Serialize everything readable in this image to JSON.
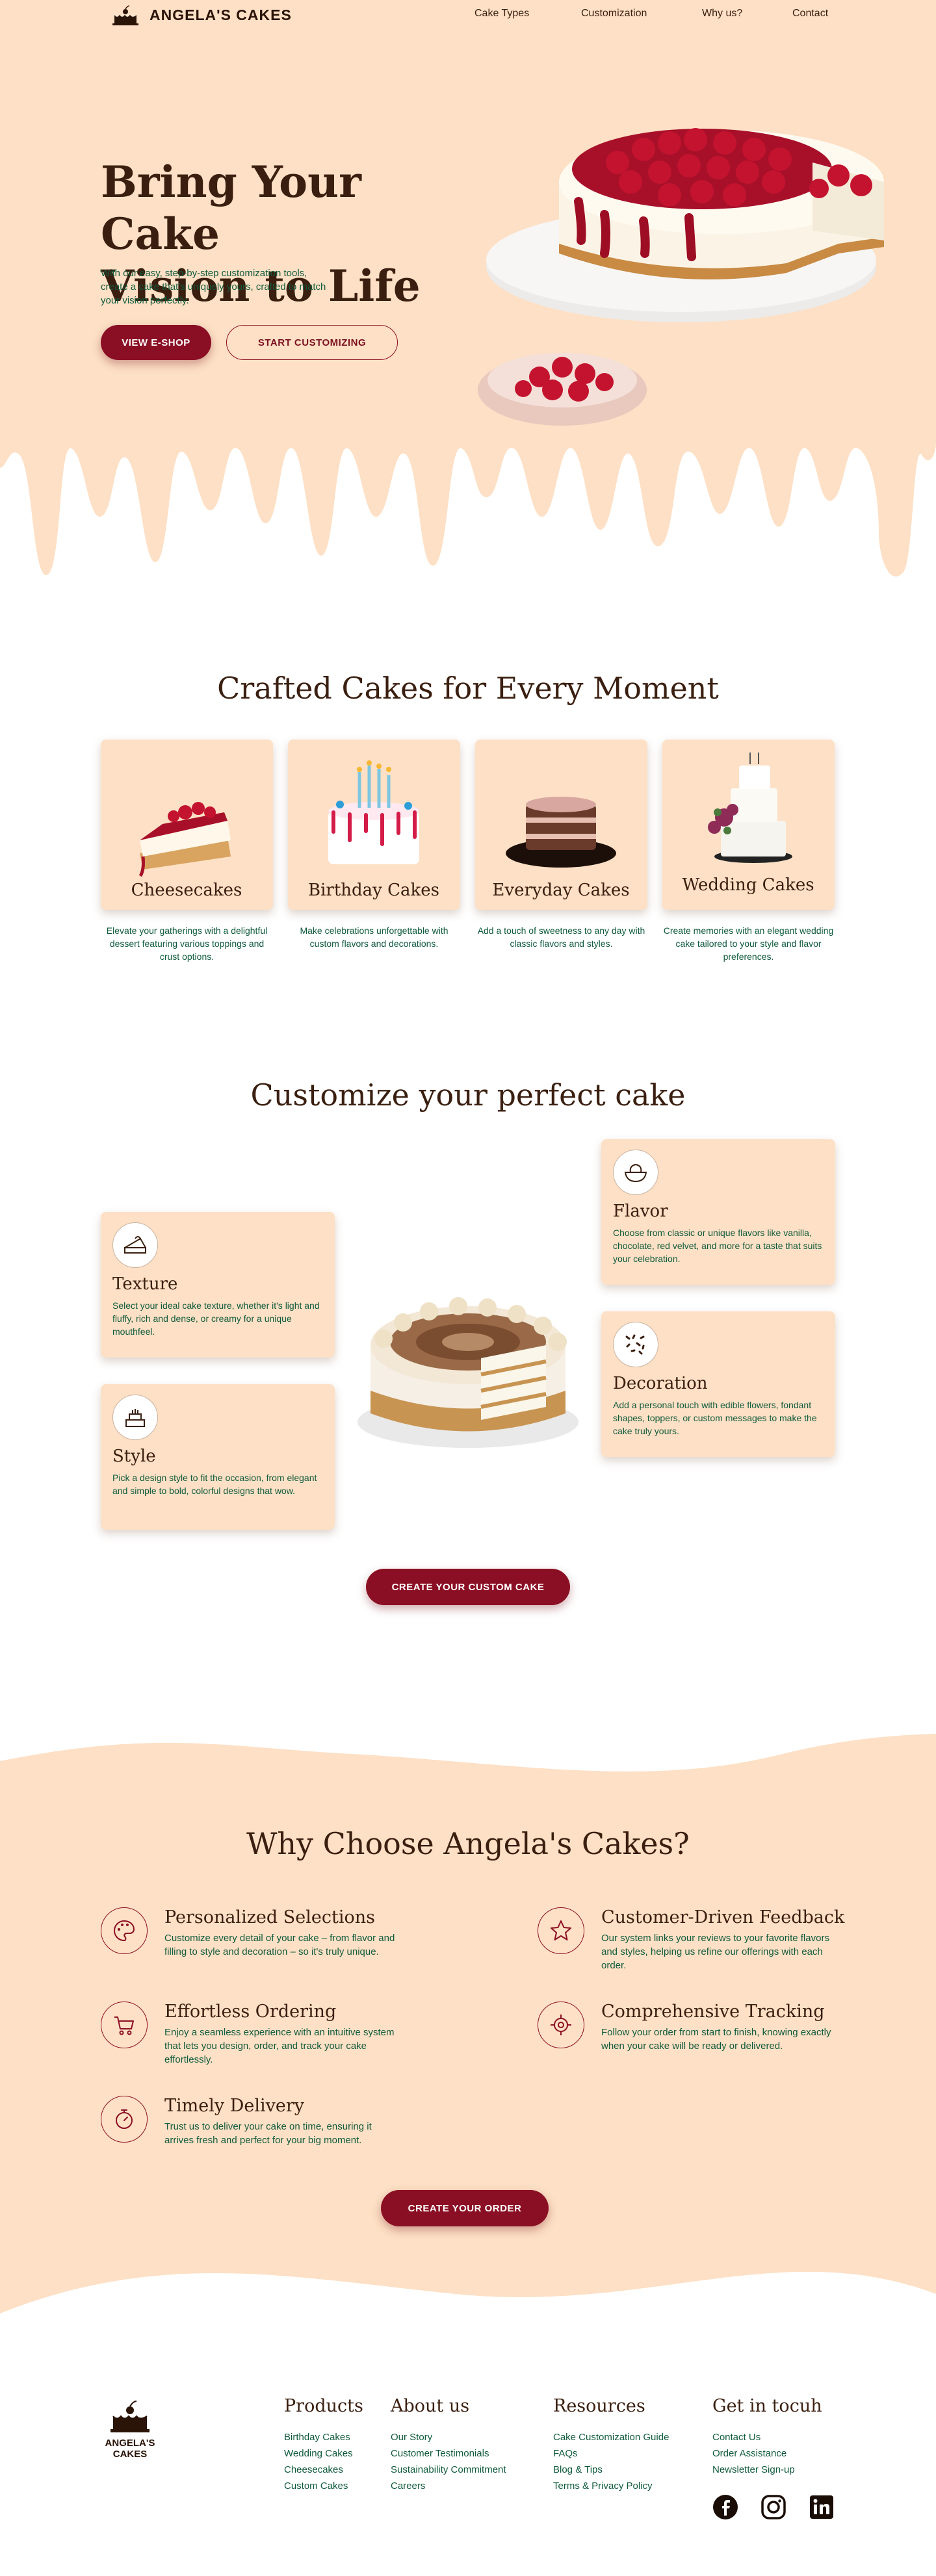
{
  "header": {
    "logo_text": "ANGELA'S CAKES",
    "nav": [
      {
        "label": "Cake Types"
      },
      {
        "label": "Customization"
      },
      {
        "label": "Why us?"
      },
      {
        "label": "Contact"
      }
    ]
  },
  "hero": {
    "title_line1": "Bring Your Cake",
    "title_line2": "Vision to Life",
    "subtitle": "With our easy, step-by-step customization tools, create a cake that's uniquely yours, crafted to match your vision perfectly.",
    "primary_button": "VIEW E-SHOP",
    "secondary_button": "START CUSTOMIZING"
  },
  "categories": {
    "title": "Crafted Cakes for Every Moment",
    "items": [
      {
        "name": "Cheesecakes",
        "desc": "Elevate your gatherings with a delightful dessert featuring various toppings and crust options."
      },
      {
        "name": "Birthday Cakes",
        "desc": "Make celebrations unforgettable with custom flavors and decorations."
      },
      {
        "name": "Everyday Cakes",
        "desc": "Add a touch of sweetness to any day with classic flavors and styles."
      },
      {
        "name": "Wedding Cakes",
        "desc": "Create memories with an elegant wedding cake tailored to your style and flavor preferences."
      }
    ]
  },
  "customize": {
    "title": "Customize your perfect cake",
    "cards": [
      {
        "title": "Texture",
        "desc": "Select your ideal cake texture, whether it's light and fluffy, rich and dense, or creamy for a unique mouthfeel.",
        "icon": "cake-slice-icon"
      },
      {
        "title": "Style",
        "desc": "Pick a design style to fit the occasion, from elegant and simple to bold, colorful designs that wow.",
        "icon": "tiered-cake-icon"
      },
      {
        "title": "Flavor",
        "desc": "Choose from classic or unique flavors like vanilla, chocolate, red velvet, and more for a taste that suits your celebration.",
        "icon": "mixing-bowl-icon"
      },
      {
        "title": "Decoration",
        "desc": "Add a personal touch with edible flowers, fondant shapes, toppers, or custom messages to make the cake truly yours.",
        "icon": "sprinkles-icon"
      }
    ],
    "button": "CREATE YOUR CUSTOM CAKE"
  },
  "why": {
    "title": "Why Choose Angela's Cakes?",
    "items": [
      {
        "title": "Personalized Selections",
        "desc": "Customize every detail of your cake – from flavor and filling to style and decoration – so it's truly unique.",
        "icon": "palette-icon"
      },
      {
        "title": "Customer-Driven Feedback",
        "desc": "Our system links your reviews to your favorite flavors and styles, helping us refine our offerings with each order.",
        "icon": "star-icon"
      },
      {
        "title": "Effortless Ordering",
        "desc": "Enjoy a seamless experience with an intuitive system that lets you design, order, and track your cake effortlessly.",
        "icon": "cart-icon"
      },
      {
        "title": "Comprehensive Tracking",
        "desc": "Follow your order from start to finish, knowing exactly when your cake will be ready or delivered.",
        "icon": "target-icon"
      },
      {
        "title": "Timely Delivery",
        "desc": "Trust us to deliver your cake on time, ensuring it arrives fresh and perfect for your big moment.",
        "icon": "stopwatch-icon"
      }
    ],
    "button": "CREATE YOUR ORDER"
  },
  "footer": {
    "logo_line1": "ANGELA'S",
    "logo_line2": "CAKES",
    "columns": [
      {
        "heading": "Products",
        "links": [
          "Birthday Cakes",
          "Wedding Cakes",
          "Cheesecakes",
          "Custom Cakes"
        ]
      },
      {
        "heading": "About us",
        "links": [
          "Our Story",
          "Customer Testimonials",
          "Sustainability Commitment",
          "Careers"
        ]
      },
      {
        "heading": "Resources",
        "links": [
          "Cake Customization Guide",
          "FAQs",
          "Blog & Tips",
          "Terms & Privacy Policy"
        ]
      },
      {
        "heading": "Get in tocuh",
        "links": [
          "Contact Us",
          "Order Assistance",
          "Newsletter Sign-up"
        ]
      }
    ],
    "social": [
      "facebook-icon",
      "instagram-icon",
      "linkedin-icon"
    ]
  },
  "colors": {
    "peach": "#fde0c5",
    "burgundy": "#8b0f24",
    "brown": "#3a1f10",
    "green_text": "#0f5a3c"
  }
}
